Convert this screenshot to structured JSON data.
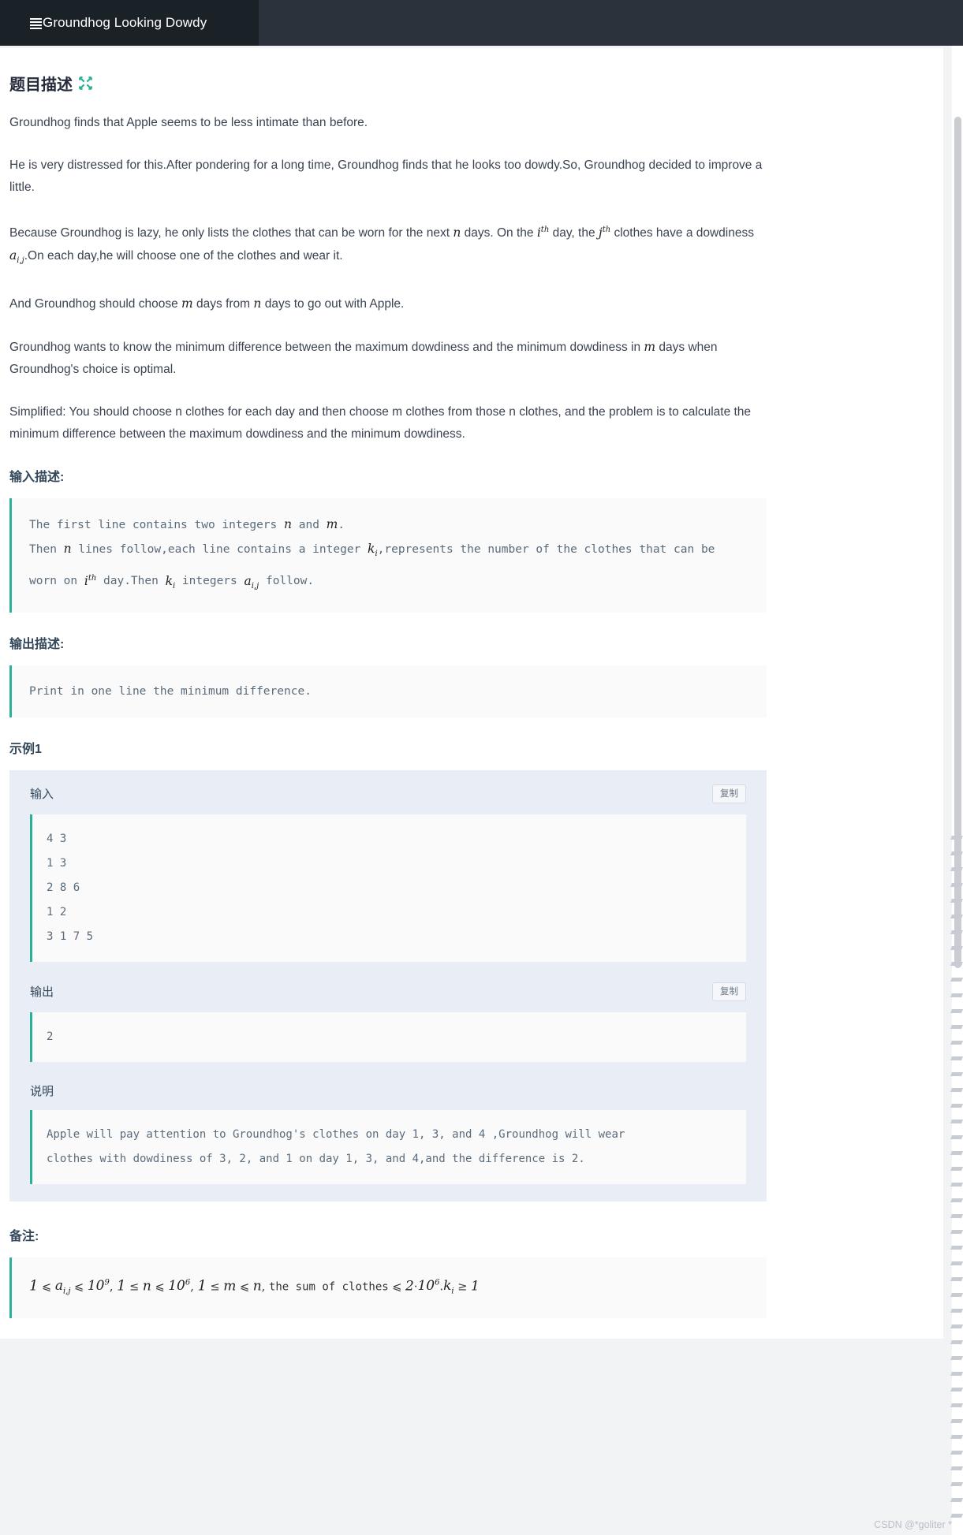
{
  "topbar": {
    "menu_icon": "list-menu-icon",
    "title": "Groundhog Looking Dowdy"
  },
  "problem": {
    "description_heading": "题目描述",
    "expand_icon": "expand-arrows-icon",
    "paragraphs": [
      "Groundhog finds that Apple seems to be less intimate than before.",
      "He is very distressed for this.After pondering for a long time, Groundhog finds that he looks too dowdy.So, Groundhog decided to improve a little.",
      "Because Groundhog is lazy, he only lists the clothes that can be worn for the next n days. On the ith day, the jth clothes have a dowdiness ai,j.On each day,he will choose one of the clothes and wear it.",
      "And Groundhog should choose m days from n days to go out with Apple.",
      "Groundhog wants to know the minimum difference between the maximum dowdiness and the minimum dowdiness in m days when Groundhog's choice is optimal.",
      "Simplified: You should choose n clothes for each day and then choose m clothes from those n clothes, and the problem is to calculate the minimum difference between the maximum dowdiness and the minimum dowdiness."
    ],
    "input_heading": "输入描述:",
    "input_desc": "The first line contains two integers n and m.\nThen n lines follow,each line contains a integer ki,represents the number of the clothes that can be worn on ith day.Then ki integers ai,j follow.",
    "output_heading": "输出描述:",
    "output_desc": "Print in one line the minimum difference.",
    "example_heading": "示例1",
    "example": {
      "input_label": "输入",
      "copy_label": "复制",
      "input_value": "4 3\n1 3\n2 8 6\n1 2\n3 1 7 5",
      "output_label": "输出",
      "output_copy_label": "复制",
      "output_value": "2",
      "note_label": "说明",
      "note_value": "Apple will pay attention to Groundhog's clothes on day 1, 3, and 4 ,Groundhog will wear\nclothes with dowdiness of 3, 2, and 1 on day 1, 3, and 4,and the difference is 2."
    },
    "remark_heading": "备注:",
    "remark_value": "1 ⩽ ai,j ⩽ 109, 1 ≤ n ⩽ 106, 1 ≤ m ⩽ n, the sum of clothes ⩽ 2·106. ki ≥ 1"
  },
  "watermark": "CSDN @*goliter *",
  "colors": {
    "topbar_dark": "#1b2227",
    "topbar": "#2b323b",
    "accent_teal": "#2bb198",
    "heading": "#33475b",
    "sample_bg": "#e9edf5",
    "code_bg": "#fafafa"
  }
}
